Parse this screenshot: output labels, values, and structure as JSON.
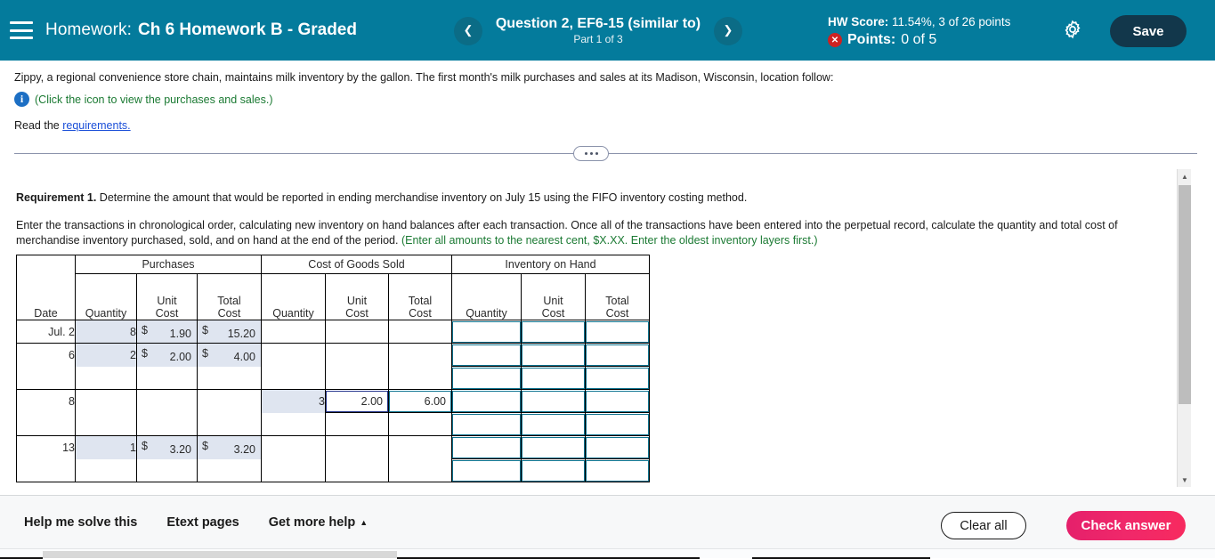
{
  "header": {
    "menu_icon": "hamburger-icon",
    "homework_label": "Homework:",
    "assignment_title": "Ch 6 Homework B - Graded",
    "prev_icon": "chevron-left-icon",
    "next_icon": "chevron-right-icon",
    "question_title": "Question 2, EF6-15 (similar to)",
    "question_part": "Part 1 of 3",
    "hw_score_label": "HW Score:",
    "hw_score_value": "11.54%, 3 of 26 points",
    "points_label": "Points:",
    "points_value": "0 of 5",
    "points_status_icon": "error-x-icon",
    "settings_icon": "gear-icon",
    "save_label": "Save",
    "accent_color": "#047b9c",
    "save_color": "#12374b",
    "error_color": "#cc2222"
  },
  "statement": {
    "paragraph": "Zippy, a regional convenience store chain, maintains milk inventory by the gallon. The first month's milk purchases and sales at its Madison, Wisconsin, location follow:",
    "info_icon": "info-circle-icon",
    "info_text": "(Click the icon to view the purchases and sales.)",
    "read_prefix": "Read the",
    "requirements_link": "requirements."
  },
  "divider": {
    "dots_icon": "ellipsis-icon"
  },
  "requirement": {
    "label": "Requirement 1.",
    "heading": "Determine the amount that would be reported in ending merchandise inventory on July 15 using the FIFO inventory costing method.",
    "body": "Enter the transactions in chronological order, calculating new inventory on hand balances after each transaction. Once all of the transactions have been entered into the perpetual record, calculate the quantity and total cost of merchandise inventory purchased, sold, and on hand at the end of the period.",
    "body_hint": "(Enter all amounts to the nearest cent, $X.XX. Enter the oldest inventory layers first.)"
  },
  "table": {
    "group_headers": [
      "",
      "Purchases",
      "Cost of Goods Sold",
      "Inventory on Hand"
    ],
    "sub_headers": {
      "date": "Date",
      "purchases": [
        "Quantity",
        "Unit Cost",
        "Total Cost"
      ],
      "cogs": [
        "Quantity",
        "Unit Cost",
        "Total Cost"
      ],
      "onhand": [
        "Quantity",
        "Unit Cost",
        "Total Cost"
      ]
    },
    "unit_line1": "Unit",
    "unit_line2": "Cost",
    "total_line1": "Total",
    "total_line2": "Cost",
    "rows": [
      {
        "date": "Jul. 2",
        "p_qty": "8",
        "p_unit_sym": "$",
        "p_unit": "1.90",
        "p_total_sym": "$",
        "p_total": "15.20"
      },
      {
        "date": "6",
        "p_qty": "2",
        "p_unit_sym": "$",
        "p_unit": "2.00",
        "p_total_sym": "$",
        "p_total": "4.00"
      },
      {
        "date": "",
        "p_qty": "",
        "p_unit": "",
        "p_total": ""
      },
      {
        "date": "8",
        "c_qty": "3",
        "c_unit": "2.00",
        "c_total": "6.00"
      },
      {
        "date": "",
        "c_qty": "",
        "c_unit": "",
        "c_total": ""
      },
      {
        "date": "13",
        "p_qty": "1",
        "p_unit_sym": "$",
        "p_unit": "3.20",
        "p_total_sym": "$",
        "p_total": "3.20"
      },
      {
        "date": "",
        "p_qty": "",
        "p_unit": "",
        "p_total": ""
      }
    ]
  },
  "scrollbars": {
    "vertical_up_icon": "triangle-up-icon",
    "vertical_down_icon": "triangle-down-icon"
  },
  "footer": {
    "help_solve": "Help me solve this",
    "etext_pages": "Etext pages",
    "more_help": "Get more help",
    "more_help_icon": "caret-up-icon",
    "clear_all": "Clear all",
    "check_answer": "Check answer",
    "check_color": "#f0286a"
  }
}
